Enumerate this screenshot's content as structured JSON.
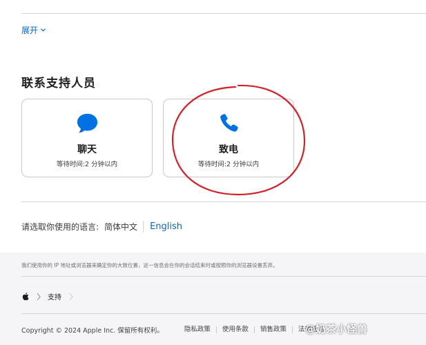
{
  "expand": {
    "label": "展开"
  },
  "contact": {
    "title": "联系支持人员",
    "cards": [
      {
        "title": "聊天",
        "wait": "等待时间:2 分钟以内",
        "icon": "chat-bubble-icon"
      },
      {
        "title": "致电",
        "wait": "等待时间:2 分钟以内",
        "icon": "phone-icon"
      }
    ]
  },
  "language": {
    "label": "请选取你使用的语言:",
    "current": "简体中文",
    "alternate": "English"
  },
  "footer": {
    "privacy_notice": "我们使用你的 IP 地址或浏览器来确定你的大致位置，这一信息会在你的会话结束时或按照你的浏览器设置丢弃。",
    "breadcrumb": {
      "home_icon": "apple-logo-icon",
      "support": "支持"
    },
    "copyright": "Copyright © 2024 Apple Inc. 保留所有权利。",
    "links": [
      "隐私政策",
      "使用条款",
      "销售政策",
      "法律信息"
    ],
    "watermark": "@奶茶小怪兽"
  },
  "colors": {
    "link": "#0066cc",
    "icon_blue": "#0071e3",
    "annotation_red": "#d61f26"
  }
}
